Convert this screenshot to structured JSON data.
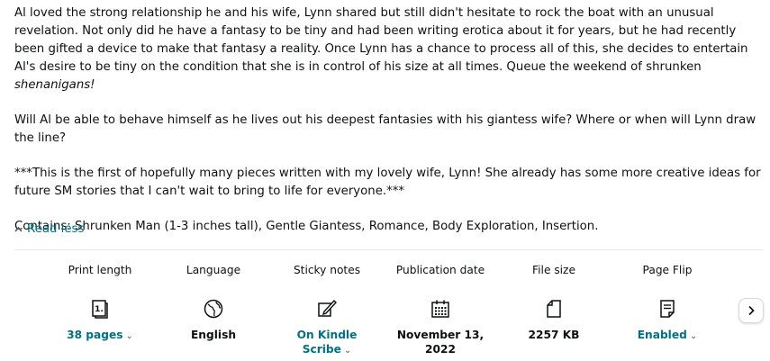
{
  "description": {
    "para1_a": "Al loved the strong relationship he and his wife, Lynn shared but still didn't hesitate to rock the boat with an unusual revelation. Not only did he have a fantasy to be tiny and had been writing erotica about it for years, but he had recently been gifted a device to make that fantasy a reality. Once Lynn has a chance to process all of this, she decides to entertain Al's desire to be tiny on the condition that she is in control of his size at all times. Queue the weekend of shrunken ",
    "para1_em": "shenanigans!",
    "para2": "Will Al be able to behave himself as he lives out his deepest fantasies with his giantess wife? Where or when will Lynn draw the line?",
    "para3": "***This is the first of hopefully many pieces written with my lovely wife, Lynn! She already has some more creative ideas for future SM stories that I can't wait to bring to life for everyone.***",
    "para4": "Contains: Shrunken Man (1-3 inches tall), Gentle Giantess, Romance, Body Exploration, Insertion."
  },
  "read_less": "Read less",
  "details": {
    "print_length": {
      "label": "Print length",
      "value": "38 pages",
      "icon": "book-page-icon"
    },
    "language": {
      "label": "Language",
      "value": "English",
      "icon": "globe-icon"
    },
    "sticky_notes": {
      "label": "Sticky notes",
      "value": "On Kindle Scribe",
      "icon": "pen-note-icon"
    },
    "publication_date": {
      "label": "Publication date",
      "value": "November 13, 2022",
      "icon": "calendar-icon"
    },
    "file_size": {
      "label": "File size",
      "value": "2257 KB",
      "icon": "file-icon"
    },
    "page_flip": {
      "label": "Page Flip",
      "value": "Enabled",
      "icon": "page-flip-icon"
    }
  },
  "colors": {
    "link": "#007185",
    "text": "#0f1111",
    "divider": "#e7e7e7"
  }
}
